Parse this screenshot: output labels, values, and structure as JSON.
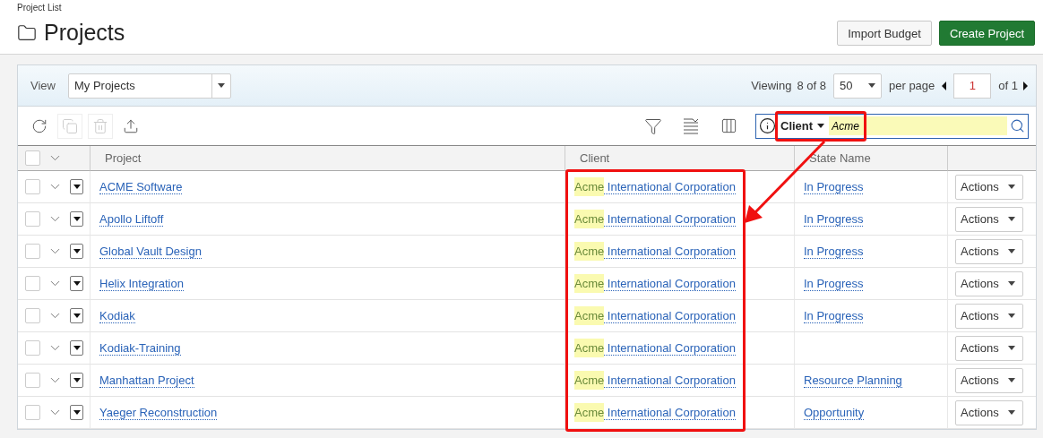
{
  "breadcrumb": "Project List",
  "title": "Projects",
  "header_buttons": [
    {
      "label": "Import Budget",
      "kind": "secondary"
    },
    {
      "label": "Create Project",
      "kind": "primary"
    }
  ],
  "view": {
    "label": "View",
    "value": "My Projects"
  },
  "paging": {
    "viewing": "Viewing",
    "count": "8 of 8",
    "per_page_value": "50",
    "per_page": "per page",
    "page": "1",
    "of": "of 1"
  },
  "toolbar": [
    {
      "kind": "refresh",
      "disabled": false
    },
    {
      "kind": "copy",
      "disabled": true
    },
    {
      "kind": "delete",
      "disabled": true
    },
    {
      "kind": "export",
      "disabled": false
    }
  ],
  "search": {
    "scope": "Client",
    "value": "Acme"
  },
  "table": {
    "select_all_checked": false,
    "columns": [
      "Project",
      "Client",
      "State Name"
    ],
    "rows": [
      {
        "checked": false,
        "project": "ACME Software",
        "client_match": "Acme",
        "client_rest": " International Corporation",
        "state": "In Progress",
        "action": "Actions"
      },
      {
        "checked": false,
        "project": "Apollo Liftoff",
        "client_match": "Acme",
        "client_rest": " International Corporation",
        "state": "In Progress",
        "action": "Actions"
      },
      {
        "checked": false,
        "project": "Global Vault Design",
        "client_match": "Acme",
        "client_rest": " International Corporation",
        "state": "In Progress",
        "action": "Actions"
      },
      {
        "checked": false,
        "project": "Helix Integration",
        "client_match": "Acme",
        "client_rest": " International Corporation",
        "state": "In Progress",
        "action": "Actions"
      },
      {
        "checked": false,
        "project": "Kodiak",
        "client_match": "Acme",
        "client_rest": " International Corporation",
        "state": "In Progress",
        "action": "Actions"
      },
      {
        "checked": false,
        "project": "Kodiak-Training",
        "client_match": "Acme",
        "client_rest": " International Corporation",
        "action": "Actions"
      },
      {
        "checked": false,
        "project": "Manhattan Project",
        "client_match": "Acme",
        "client_rest": " International Corporation",
        "state": "Resource Planning",
        "action": "Actions"
      },
      {
        "checked": false,
        "project": "Yaeger Reconstruction",
        "client_match": "Acme",
        "client_rest": " International Corporation",
        "state": "Opportunity",
        "action": "Actions"
      }
    ]
  }
}
